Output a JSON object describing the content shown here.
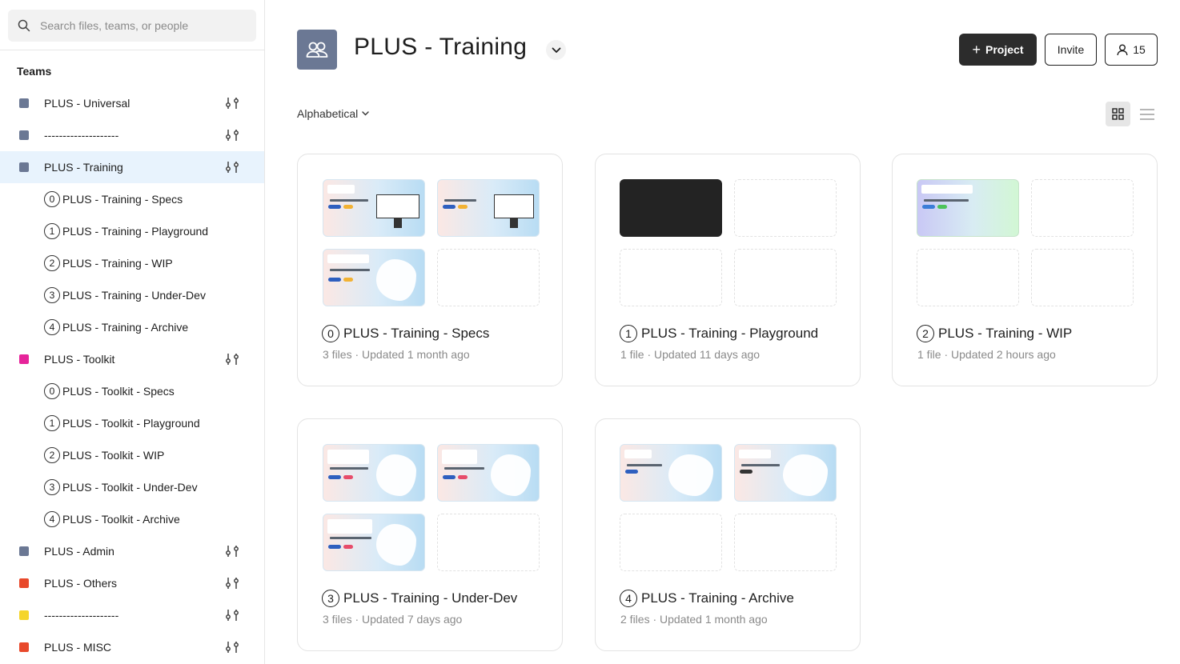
{
  "search": {
    "placeholder": "Search files, teams, or people"
  },
  "sidebar": {
    "heading": "Teams",
    "items": [
      {
        "type": "team",
        "label": "PLUS - Universal",
        "color": "#6b7894"
      },
      {
        "type": "team",
        "label": "--------------------",
        "color": "#6b7894"
      },
      {
        "type": "team",
        "label": "PLUS - Training",
        "color": "#6b7894",
        "active": true
      },
      {
        "type": "project",
        "num": "0",
        "label": "PLUS - Training - Specs"
      },
      {
        "type": "project",
        "num": "1",
        "label": "PLUS - Training - Playground"
      },
      {
        "type": "project",
        "num": "2",
        "label": "PLUS - Training - WIP"
      },
      {
        "type": "project",
        "num": "3",
        "label": "PLUS - Training - Under-Dev"
      },
      {
        "type": "project",
        "num": "4",
        "label": "PLUS - Training - Archive"
      },
      {
        "type": "team",
        "label": "PLUS - Toolkit",
        "color": "#e6249a"
      },
      {
        "type": "project",
        "num": "0",
        "label": "PLUS - Toolkit - Specs"
      },
      {
        "type": "project",
        "num": "1",
        "label": "PLUS - Toolkit - Playground"
      },
      {
        "type": "project",
        "num": "2",
        "label": "PLUS - Toolkit - WIP"
      },
      {
        "type": "project",
        "num": "3",
        "label": "PLUS - Toolkit - Under-Dev"
      },
      {
        "type": "project",
        "num": "4",
        "label": "PLUS - Toolkit - Archive"
      },
      {
        "type": "team",
        "label": "PLUS - Admin",
        "color": "#6b7894"
      },
      {
        "type": "team",
        "label": "PLUS - Others",
        "color": "#e8492b"
      },
      {
        "type": "team",
        "label": "--------------------",
        "color": "#f5d52a"
      },
      {
        "type": "team",
        "label": "PLUS - MISC",
        "color": "#e8492b"
      }
    ]
  },
  "header": {
    "title": "PLUS - Training",
    "project_button": "Project",
    "invite_button": "Invite",
    "members_count": "15",
    "accent": "#2c2c2c"
  },
  "sort": {
    "label": "Alphabetical"
  },
  "projects": [
    {
      "num": "0",
      "title": "PLUS - Training - Specs",
      "meta": "3 files · Updated 1 month ago"
    },
    {
      "num": "1",
      "title": "PLUS - Training - Playground",
      "meta": "1 file · Updated 11 days ago"
    },
    {
      "num": "2",
      "title": "PLUS - Training - WIP",
      "meta": "1 file · Updated 2 hours ago"
    },
    {
      "num": "3",
      "title": "PLUS - Training - Under-Dev",
      "meta": "3 files · Updated 7 days ago"
    },
    {
      "num": "4",
      "title": "PLUS - Training - Archive",
      "meta": "2 files · Updated 1 month ago"
    }
  ]
}
